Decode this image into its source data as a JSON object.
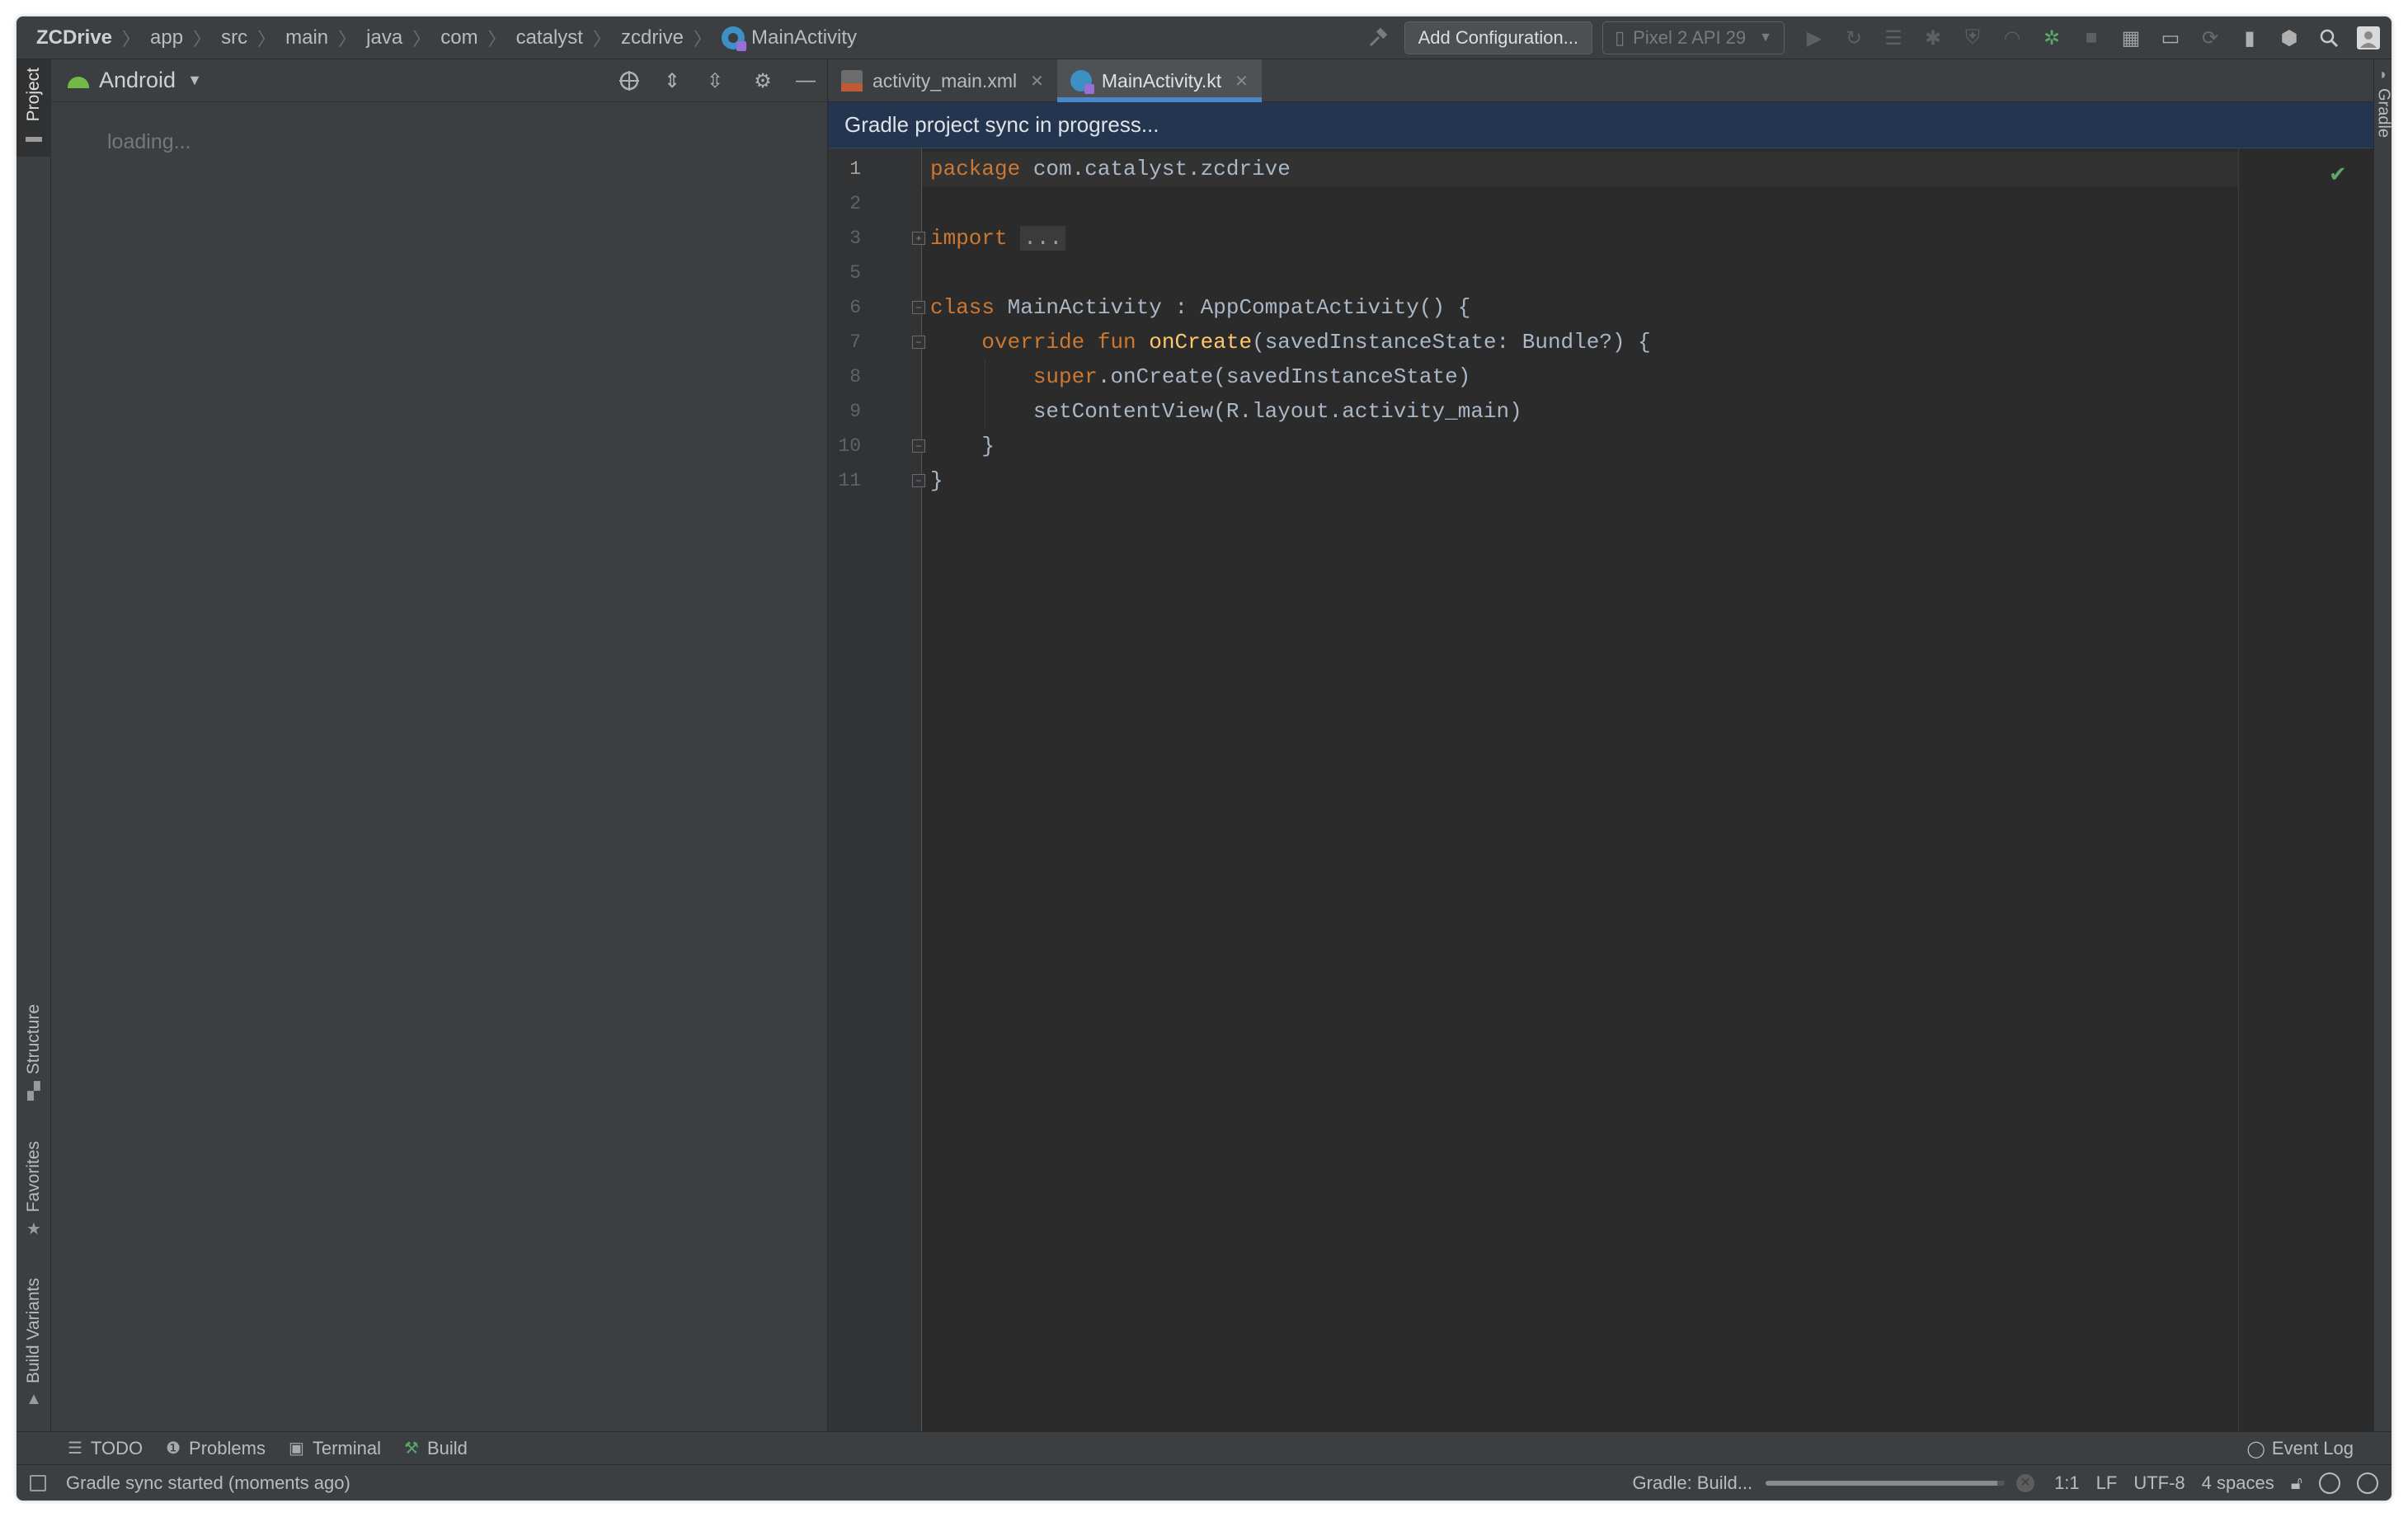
{
  "breadcrumb": [
    "ZCDrive",
    "app",
    "src",
    "main",
    "java",
    "com",
    "catalyst",
    "zcdrive",
    "MainActivity"
  ],
  "toolbar": {
    "add_configuration": "Add Configuration...",
    "device": "Pixel 2 API 29"
  },
  "left_tool_windows": [
    "Project",
    "Structure",
    "Favorites",
    "Build Variants"
  ],
  "right_tool_windows": [
    "Gradle"
  ],
  "project_panel": {
    "view_mode": "Android",
    "status": "loading..."
  },
  "editor": {
    "tabs": [
      {
        "label": "activity_main.xml",
        "active": false
      },
      {
        "label": "MainActivity.kt",
        "active": true
      }
    ],
    "banner": "Gradle project sync in progress...",
    "line_numbers": [
      "1",
      "2",
      "3",
      "5",
      "6",
      "7",
      "8",
      "9",
      "10",
      "11"
    ],
    "code": {
      "l1_kw": "package",
      "l1_rest": " com.catalyst.zcdrive",
      "l3_kw": "import",
      "l3_folded": "...",
      "l6_kw": "class",
      "l6_rest": " MainActivity : AppCompatActivity() {",
      "l7_kw": "override fun",
      "l7_fn": "onCreate",
      "l7_rest": "(savedInstanceState: Bundle?) {",
      "l8_kw": "super",
      "l8_rest": ".onCreate(savedInstanceState)",
      "l9": "setContentView(R.layout.activity_main)",
      "l10": "}",
      "l11": "}"
    }
  },
  "bottom_tools": [
    "TODO",
    "Problems",
    "Terminal",
    "Build"
  ],
  "event_log": "Event Log",
  "status_bar": {
    "message": "Gradle sync started (moments ago)",
    "task": "Gradle: Build...",
    "progress_fraction": 0.97,
    "position": "1:1",
    "line_separator": "LF",
    "encoding": "UTF-8",
    "indent": "4 spaces"
  },
  "colors": {
    "keyword": "#cc7832",
    "function": "#ffc66d",
    "text": "#a9b7c6",
    "banner": "#23354f",
    "active_tab_underline": "#4a88c7"
  }
}
